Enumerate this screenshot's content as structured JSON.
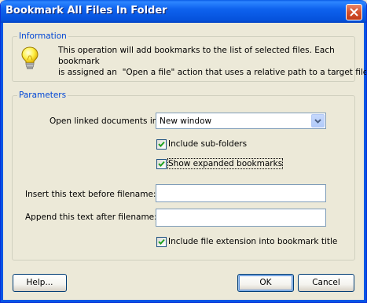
{
  "window": {
    "title": "Bookmark All Files In Folder"
  },
  "information": {
    "legend": "Information",
    "line1": "This operation will add bookmarks to the list of selected files. Each bookmark",
    "line2": "is assigned an  \"Open a file\" action that uses a relative path to a target file."
  },
  "parameters": {
    "legend": "Parameters",
    "open_linked_label": "Open linked documents in:",
    "open_linked_value": "New window",
    "include_subfolders": {
      "label": "Include sub-folders",
      "checked": true
    },
    "show_expanded": {
      "label": "Show expanded bookmarks",
      "checked": true
    },
    "insert_before_label": "Insert this text before filename:",
    "insert_before_value": "",
    "append_after_label": "Append this text after filename:",
    "append_after_value": "",
    "include_extension": {
      "label": "Include file extension into bookmark title",
      "checked": true
    }
  },
  "buttons": {
    "help": "Help...",
    "ok": "OK",
    "cancel": "Cancel"
  },
  "icons": {
    "info": "lightbulb-icon",
    "close": "close-icon",
    "dropdown": "chevron-down-icon",
    "check": "checkmark-icon"
  }
}
